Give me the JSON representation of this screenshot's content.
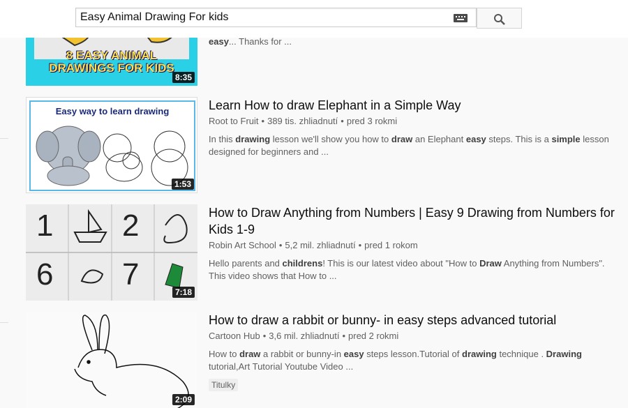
{
  "search": {
    "query": "Easy Animal Drawing For kids"
  },
  "top_result": {
    "thumb_text_line1": "8 EASY ANIMAL",
    "thumb_text_line2": "DRAWINGS FOR KIDS",
    "duration": "8:35",
    "desc_bold": "easy",
    "desc_rest": "... Thanks for ..."
  },
  "results": [
    {
      "title": "Learn How to draw Elephant in a Simple Way",
      "channel": "Root to Fruit",
      "views": "389 tis. zhliadnutí",
      "age": "pred 3 rokmi",
      "duration": "1:53",
      "thumb_caption": "Easy way to learn drawing",
      "desc": [
        {
          "t": "In this ",
          "b": false
        },
        {
          "t": "drawing",
          "b": true
        },
        {
          "t": " lesson we'll show you how to ",
          "b": false
        },
        {
          "t": "draw",
          "b": true
        },
        {
          "t": " an Elephant ",
          "b": false
        },
        {
          "t": "easy",
          "b": true
        },
        {
          "t": " steps. This is a ",
          "b": false
        },
        {
          "t": "simple",
          "b": true
        },
        {
          "t": " lesson designed for beginners and ...",
          "b": false
        }
      ]
    },
    {
      "title": "How to Draw Anything from Numbers | Easy 9 Drawing from Numbers for Kids 1-9",
      "channel": "Robin Art School",
      "views": "5,2 mil. zhliadnutí",
      "age": "pred 1 rokom",
      "duration": "7:18",
      "thumb_numbers": [
        "1",
        "2",
        "6",
        "7"
      ],
      "desc": [
        {
          "t": "Hello parents and ",
          "b": false
        },
        {
          "t": "childrens",
          "b": true
        },
        {
          "t": "! This is our latest video about \"How to ",
          "b": false
        },
        {
          "t": "Draw",
          "b": true
        },
        {
          "t": " Anything from Numbers\". This video shows that How to ...",
          "b": false
        }
      ]
    },
    {
      "title": "How to draw a rabbit or bunny- in easy steps advanced tutorial",
      "channel": "Cartoon Hub",
      "views": "3,6 mil. zhliadnutí",
      "age": "pred 2 rokmi",
      "duration": "2:09",
      "badge": "Titulky",
      "desc": [
        {
          "t": "How to ",
          "b": false
        },
        {
          "t": "draw",
          "b": true
        },
        {
          "t": " a rabbit or bunny-in ",
          "b": false
        },
        {
          "t": "easy",
          "b": true
        },
        {
          "t": " steps lesson.Tutorial of ",
          "b": false
        },
        {
          "t": "drawing",
          "b": true
        },
        {
          "t": " technique . ",
          "b": false
        },
        {
          "t": "Drawing",
          "b": true
        },
        {
          "t": " tutorial,Art Tutorial Youtube Video ...",
          "b": false
        }
      ]
    }
  ]
}
